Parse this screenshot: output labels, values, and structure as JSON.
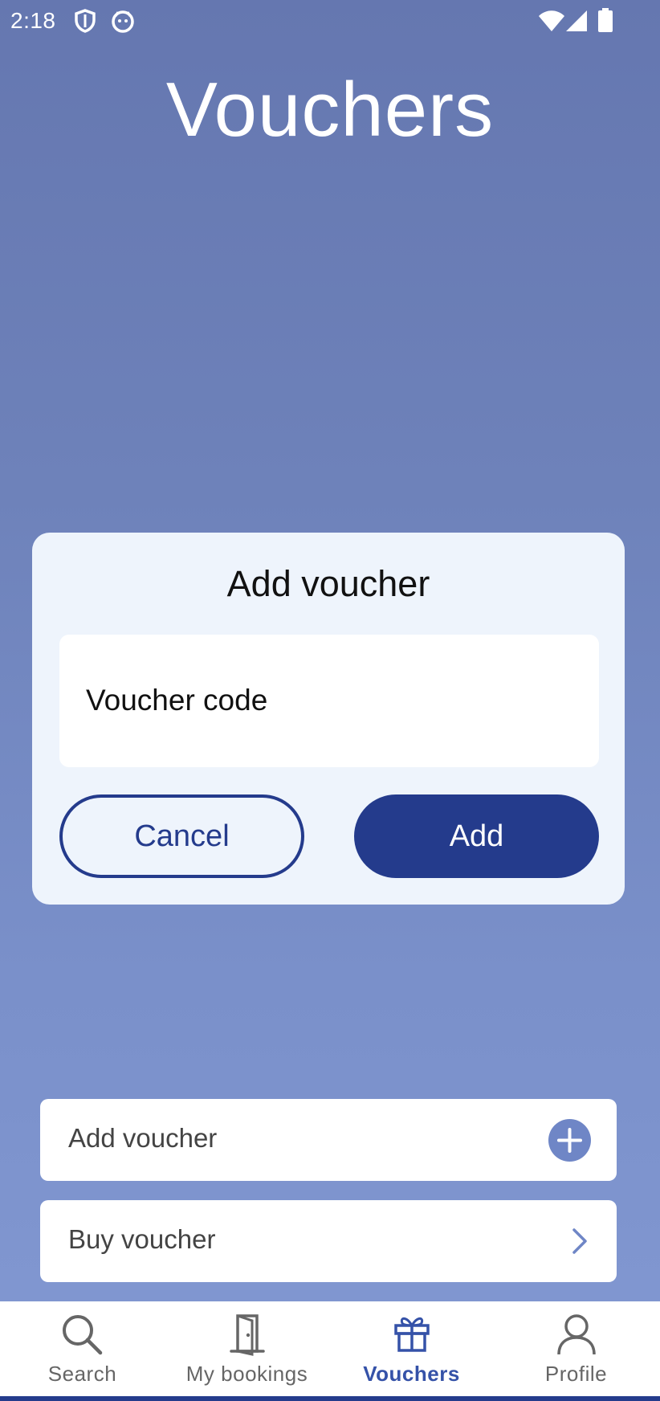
{
  "status_bar": {
    "time": "2:18",
    "icons": [
      "shield-icon",
      "face-icon",
      "wifi-icon",
      "signal-icon",
      "battery-icon"
    ]
  },
  "page": {
    "title": "Vouchers"
  },
  "dialog": {
    "title": "Add voucher",
    "code_field_placeholder": "Voucher code",
    "cancel_label": "Cancel",
    "add_label": "Add"
  },
  "list": {
    "add_voucher_label": "Add voucher",
    "buy_voucher_label": "Buy voucher"
  },
  "bottom_nav": {
    "items": [
      {
        "label": "Search",
        "icon": "search-icon"
      },
      {
        "label": "My bookings",
        "icon": "door-icon"
      },
      {
        "label": "Vouchers",
        "icon": "gift-icon",
        "active": true
      },
      {
        "label": "Profile",
        "icon": "person-icon"
      }
    ]
  },
  "colors": {
    "primary": "#243b8c",
    "active_nav": "#3552a8",
    "background_top": "#6577b0",
    "background_bottom": "#8298d2",
    "dialog_bg": "#eef4fc",
    "plus_icon": "#6f86c6"
  }
}
